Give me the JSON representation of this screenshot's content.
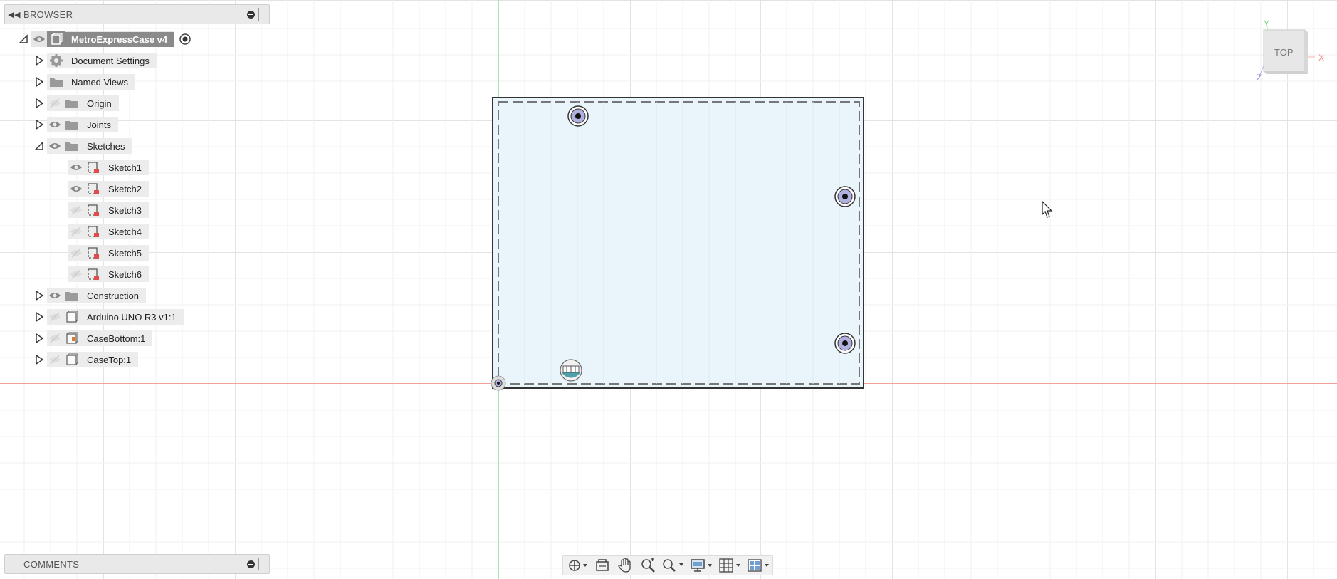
{
  "browser": {
    "title": "BROWSER",
    "root": {
      "label": "MetroExpressCase v4"
    },
    "items": [
      {
        "label": "Document Settings",
        "icon": "gear-icon"
      },
      {
        "label": "Named Views",
        "icon": "folder-icon"
      },
      {
        "label": "Origin",
        "icon": "folder-icon",
        "visible": false
      },
      {
        "label": "Joints",
        "icon": "folder-icon",
        "visible": true
      },
      {
        "label": "Sketches",
        "icon": "folder-icon",
        "visible": true,
        "expanded": true
      },
      {
        "label": "Sketch1",
        "icon": "sketch-icon",
        "visible": true
      },
      {
        "label": "Sketch2",
        "icon": "sketch-icon",
        "visible": true
      },
      {
        "label": "Sketch3",
        "icon": "sketch-icon",
        "visible": false
      },
      {
        "label": "Sketch4",
        "icon": "sketch-icon",
        "visible": false
      },
      {
        "label": "Sketch5",
        "icon": "sketch-icon",
        "visible": false
      },
      {
        "label": "Sketch6",
        "icon": "sketch-icon",
        "visible": false
      },
      {
        "label": "Construction",
        "icon": "folder-icon",
        "visible": true
      },
      {
        "label": "Arduino UNO R3 v1:1",
        "icon": "component-icon",
        "visible": false
      },
      {
        "label": "CaseBottom:1",
        "icon": "component-icon",
        "visible": false
      },
      {
        "label": "CaseTop:1",
        "icon": "component-icon",
        "visible": false
      }
    ]
  },
  "comments": {
    "title": "COMMENTS"
  },
  "viewcube": {
    "face": "TOP",
    "axis_x": "X",
    "axis_y": "Y",
    "axis_z": "Z"
  },
  "colors": {
    "panel": "#e9e9e9",
    "selection": "#8a8a8a",
    "x_axis": "#e8463a",
    "y_axis": "#4ad84a",
    "sketch_fill": "#eaf5fb"
  }
}
